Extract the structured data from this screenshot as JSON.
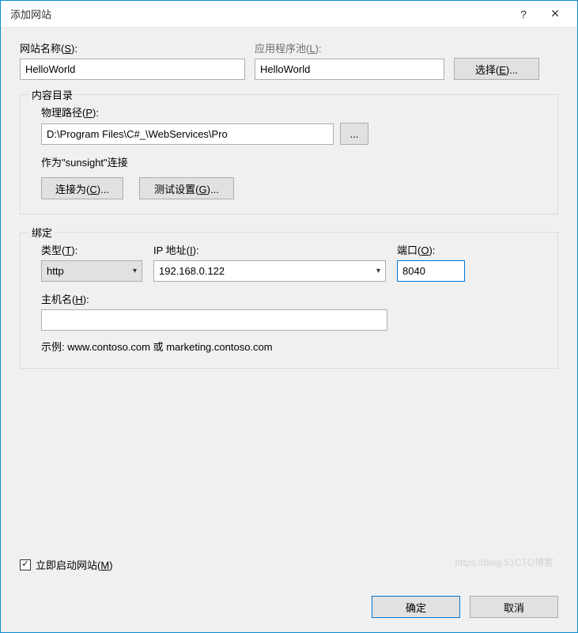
{
  "window": {
    "title": "添加网站",
    "help": "?",
    "close": "×"
  },
  "top": {
    "siteNameLabel": "网站名称(S):",
    "siteNameValue": "HelloWorld",
    "appPoolLabel": "应用程序池(L):",
    "appPoolValue": "HelloWorld",
    "selectBtn": "选择(E)..."
  },
  "contentDir": {
    "groupTitle": "内容目录",
    "physPathLabel": "物理路径(P):",
    "physPathValue": "D:\\Program Files\\C#_\\WebServices\\Pro",
    "browseBtn": "...",
    "connectText": "作为\"sunsight\"连接",
    "connectAsBtn": "连接为(C)...",
    "testBtn": "测试设置(G)..."
  },
  "binding": {
    "groupTitle": "绑定",
    "typeLabel": "类型(T):",
    "typeValue": "http",
    "ipLabel": "IP 地址(I):",
    "ipValue": "192.168.0.122",
    "portLabel": "端口(O):",
    "portValue": "8040",
    "hostLabel": "主机名(H):",
    "hostValue": "",
    "example": "示例: www.contoso.com 或 marketing.contoso.com"
  },
  "startNow": {
    "label": "立即启动网站(M)",
    "checked": true
  },
  "footer": {
    "ok": "确定",
    "cancel": "取消"
  },
  "watermark": "https://blog.51CTO博客"
}
